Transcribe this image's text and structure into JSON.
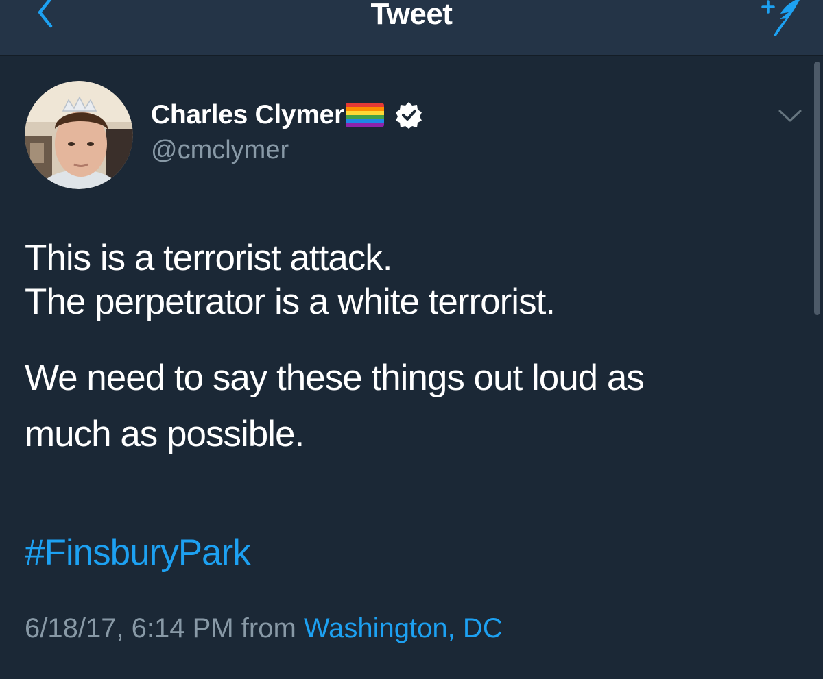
{
  "nav": {
    "title": "Tweet",
    "back_icon": "chevron-left-icon",
    "compose_icon": "compose-tweet-icon"
  },
  "tweet": {
    "author": {
      "name": "Charles Clymer",
      "handle": "@cmclymer",
      "flag_icon": "rainbow-flag-icon",
      "verified_icon": "verified-badge-icon"
    },
    "text_lines": [
      "This is a terrorist attack.",
      "The perpetrator is a white terrorist.",
      "We need to say these things out loud as",
      "much as possible."
    ],
    "hashtag": "#FinsburyPark",
    "timestamp": "6/18/17, 6:14 PM",
    "from_label": "from",
    "location": "Washington, DC"
  },
  "colors": {
    "background": "#1b2836",
    "navbar": "#243447",
    "text": "#ffffff",
    "secondary": "#8899a6",
    "accent": "#1da1f2"
  }
}
